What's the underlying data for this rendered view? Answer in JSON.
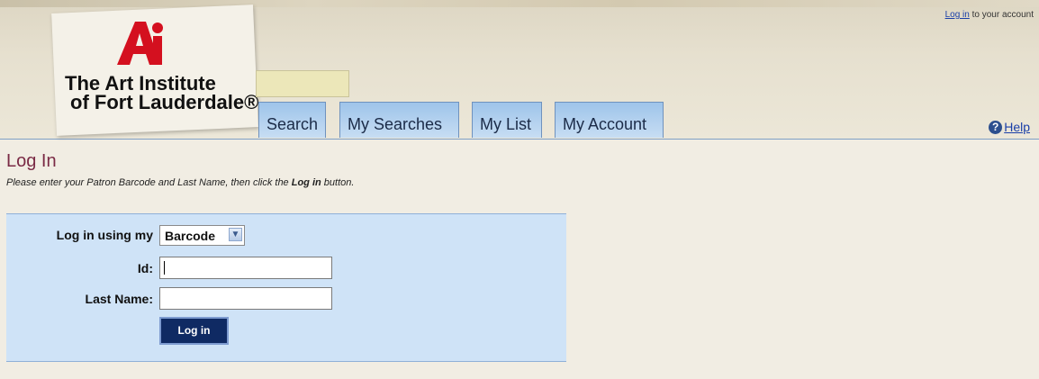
{
  "logo": {
    "mark": "Ai",
    "line1": "The Art Institute",
    "line2": "of Fort Lauderdale®",
    "brand_color": "#d4101f"
  },
  "top_login": {
    "link": "Log in",
    "rest": " to your account"
  },
  "tabs": [
    {
      "label": "Search"
    },
    {
      "label": "My Searches"
    },
    {
      "label": "My List"
    },
    {
      "label": "My Account"
    }
  ],
  "help": {
    "icon": "help-icon",
    "label": "Help"
  },
  "page": {
    "title": "Log In",
    "instructions_pre": "Please enter your Patron Barcode and Last Name, then click the ",
    "instructions_bold": "Log in",
    "instructions_post": " button."
  },
  "form": {
    "login_using_label": "Log in using my",
    "login_using_selected": "Barcode",
    "id_label": "Id:",
    "id_value": "",
    "last_name_label": "Last Name:",
    "last_name_value": "",
    "submit_label": "Log in"
  },
  "colors": {
    "accent": "#0f2a63",
    "panel": "#cfe3f7",
    "title": "#7a2a45",
    "tab": "#9ec4ea"
  }
}
